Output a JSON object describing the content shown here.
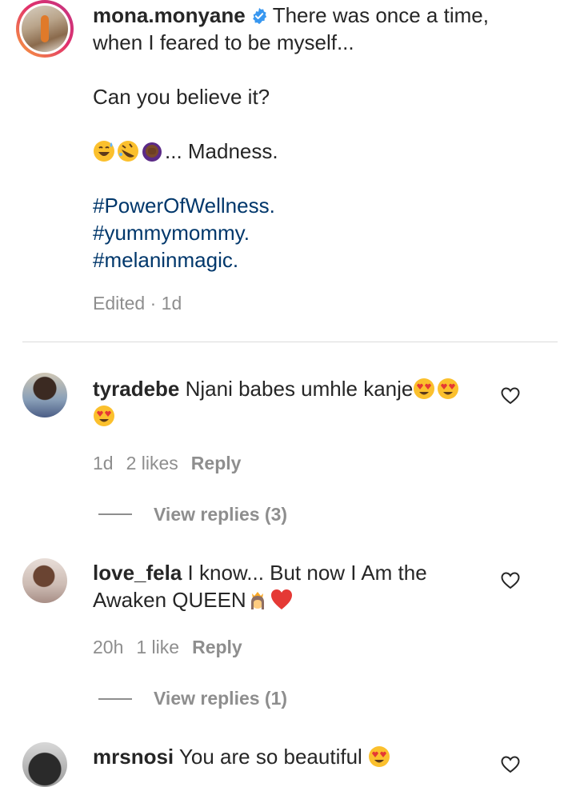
{
  "caption": {
    "username": "mona.monyane",
    "lines": [
      "There was once a time,",
      "when I feared to be myself...",
      "Can you believe it?",
      "... Madness."
    ],
    "hashtags": [
      "#PowerOfWellness.",
      "#yummymommy.",
      "#melaninmagic."
    ],
    "meta": "Edited · 1d"
  },
  "comments": [
    {
      "username": "tyradebe",
      "text_line1": "Njani babes umhle kanje",
      "time": "1d",
      "likes": "2 likes",
      "reply": "Reply",
      "view_replies": "View replies (3)"
    },
    {
      "username": "love_fela",
      "text_line1": "I know... But now I Am the",
      "text_line2": "Awaken QUEEN",
      "time": "20h",
      "likes": "1 like",
      "reply": "Reply",
      "view_replies": "View replies (1)"
    },
    {
      "username": "mrsnosi",
      "text_line1": "You are so beautiful"
    }
  ],
  "icons": {
    "verified": "verified-badge-icon",
    "like": "heart-outline-icon"
  },
  "colors": {
    "hashtag": "#00376b",
    "verified": "#3897f0",
    "muted": "#8e8e8e",
    "text": "#262626"
  }
}
